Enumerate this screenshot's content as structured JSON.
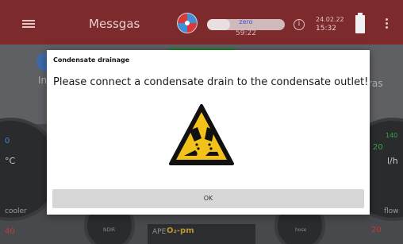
{
  "header": {
    "title": "Messgas",
    "status_label": "zero",
    "status_time": "59:22",
    "progress": 0.3,
    "date": "24.02.22",
    "time": "15:32"
  },
  "background": {
    "text_left_1": "In",
    "text_right_1": "ras",
    "gauge_left_value": "0",
    "gauge_left_unit": "°C",
    "gauge_left_label": "cooler",
    "gauge_left_bottom": "40",
    "gauge_left_small": "NDIR",
    "gauge_right_value": "20",
    "gauge_right_value2": "140",
    "gauge_right_unit": "l/h",
    "gauge_right_label": "flow",
    "gauge_right_bottom": "20",
    "gauge_right_small": "hose",
    "ape_label": "APE",
    "o2_label": "O₂-pm"
  },
  "dialog": {
    "title": "Condensate drainage",
    "message": "Please connect a condensate drain to the condensate outlet!",
    "ok_label": "OK"
  },
  "icons": {
    "menu": "menu-icon",
    "fan": "fan-icon",
    "info": "info-icon",
    "battery": "battery-icon",
    "more": "more-vertical-icon",
    "warning": "corrosive-warning-icon"
  },
  "colors": {
    "topbar": "#7d2a2d",
    "warning_yellow": "#f3c21a",
    "fan_blue": "#3f8ed8",
    "fan_red": "#d83a3a"
  }
}
